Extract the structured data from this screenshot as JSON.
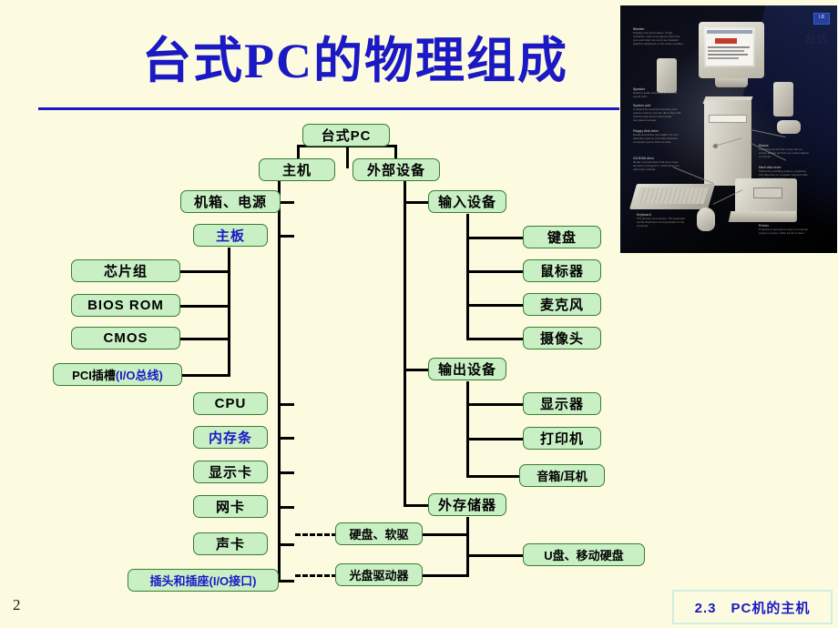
{
  "slide": {
    "title": "台式PC的物理组成",
    "page_number": "2",
    "footer_label": "2.3　PC机的主机",
    "accent_color": "#1a19c4",
    "node_fill": "#c9f0c4",
    "node_border": "#3a7a34",
    "background": "#fdfbdf"
  },
  "photo": {
    "badge_label": "LB",
    "watermark": "台式",
    "annotations": [
      {
        "title": "Monitor",
        "body": "Displays text and images. A high-resolution, well-converged monitor lets you read sharp text and view detailed graphics displayed on the screen surface."
      },
      {
        "title": "Speaker",
        "body": "Delivers audio output signal from the sound card."
      },
      {
        "title": "System unit",
        "body": "Contains the central processing unit, system memory and the drive bays that hold the disk drives that provide permanent storage."
      },
      {
        "title": "Floppy disk drive",
        "body": "Reads and writes removable 3.5-inch diskettes used to move files between computers and to back up data."
      },
      {
        "title": "CD-ROM drive",
        "body": "Reads compact discs that store large amounts of programs, multimedia and reference material."
      },
      {
        "title": "Mouse",
        "body": "A pointing device that moves the on-screen pointer and lets you select objects on screen."
      },
      {
        "title": "Hard disk drive",
        "body": "Stores the operating system, programs and data files on a sealed magnetic disk inside the system unit."
      },
      {
        "title": "Keyboard",
        "body": "The primary input device. The keyboard sends characters and keystrokes to the computer."
      },
      {
        "title": "Printer",
        "body": "Produces a permanent copy of computer output on paper, either ink-jet or laser."
      }
    ]
  },
  "tree": {
    "root": {
      "label": "台式PC",
      "style": "black"
    },
    "level1": [
      {
        "label": "主机",
        "style": "black"
      },
      {
        "label": "外部设备",
        "style": "black"
      }
    ],
    "host_children": [
      {
        "label": "机箱、电源",
        "style": "black"
      },
      {
        "label": "主板",
        "style": "blue"
      },
      {
        "label": "CPU",
        "style": "black"
      },
      {
        "label": "内存条",
        "style": "blue"
      },
      {
        "label": "显示卡",
        "style": "black"
      },
      {
        "label": "网卡",
        "style": "black"
      },
      {
        "label": "声卡",
        "style": "black"
      },
      {
        "label": "插头和插座(I/O接口)",
        "style": "blue"
      }
    ],
    "mainboard_children": [
      {
        "label": "芯片组",
        "style": "black"
      },
      {
        "label": "BIOS ROM",
        "style": "black"
      },
      {
        "label": "CMOS",
        "style": "black"
      },
      {
        "label_black": "PCI插槽",
        "label_blue": "(I/O总线)",
        "style": "mixed"
      }
    ],
    "peripheral_children": [
      {
        "label": "输入设备",
        "style": "black"
      },
      {
        "label": "输出设备",
        "style": "black"
      },
      {
        "label": "外存储器",
        "style": "black"
      }
    ],
    "input_children": [
      {
        "label": "键盘",
        "style": "black"
      },
      {
        "label": "鼠标器",
        "style": "black"
      },
      {
        "label": "麦克风",
        "style": "black"
      },
      {
        "label": "摄像头",
        "style": "black"
      }
    ],
    "output_children": [
      {
        "label": "显示器",
        "style": "black"
      },
      {
        "label": "打印机",
        "style": "black"
      },
      {
        "label": "音箱/耳机",
        "style": "black"
      }
    ],
    "storage_children": [
      {
        "label": "硬盘、软驱",
        "style": "black"
      },
      {
        "label": "光盘驱动器",
        "style": "black"
      },
      {
        "label": "U盘、移动硬盘",
        "style": "black"
      }
    ]
  }
}
